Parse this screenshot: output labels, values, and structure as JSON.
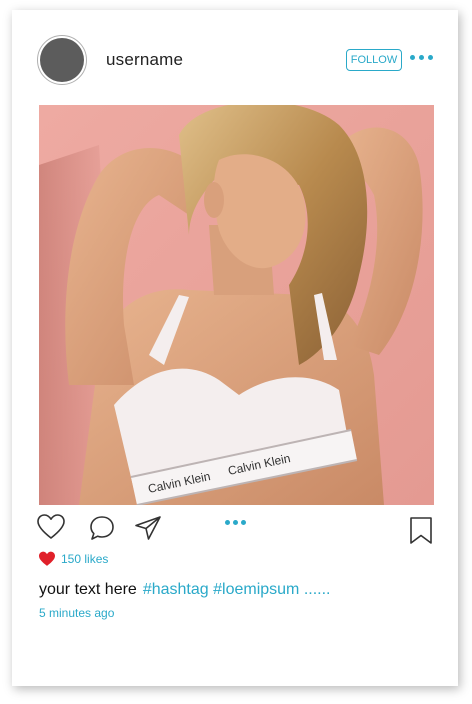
{
  "post": {
    "username": "username",
    "follow_label": "FOLLOW",
    "likes": "150 likes",
    "caption_text": "your text here",
    "caption_hashtags": "#hashtag #loemipsum ......",
    "timestamp": "5 minutes ago"
  },
  "photo": {
    "waistband_text": "Calvin Klein"
  },
  "icons": {
    "more_top": "more-horizontal-icon",
    "like": "heart-outline-icon",
    "comment": "comment-bubble-icon",
    "share": "paper-plane-icon",
    "save": "bookmark-icon",
    "liked": "heart-filled-icon"
  },
  "colors": {
    "accent": "#2aa9c9",
    "liked_heart": "#e0202a",
    "avatar": "#5c5c5c",
    "photo_background": "#e8a39c"
  }
}
